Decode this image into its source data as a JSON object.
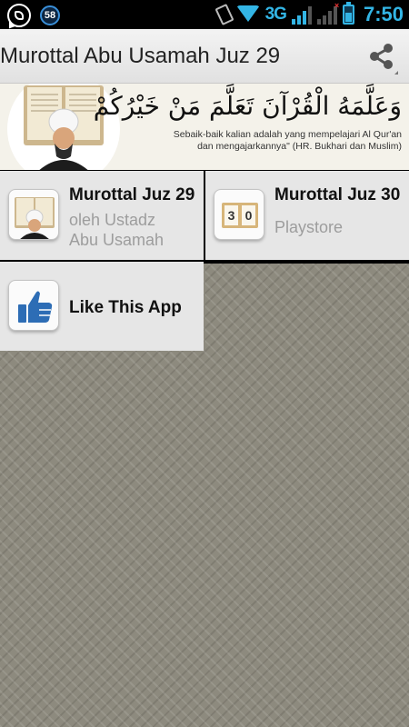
{
  "status_bar": {
    "notification_count": "58",
    "network": "3G",
    "time": "7:50",
    "accent_color": "#33b5e5"
  },
  "action_bar": {
    "title": "Murottal Abu Usamah Juz 29",
    "share_icon": "share-icon"
  },
  "banner": {
    "arabic": "وَعَلَّمَهُ الْقُرْآنَ تَعَلَّمَ مَنْ خَيْرُكُمْ",
    "translation_line1": "Sebaik-baik kalian adalah yang mempelajari Al Qur'an",
    "translation_line2": "dan mengajarkannya\" (HR. Bukhari dan Muslim)"
  },
  "tiles": [
    {
      "title": "Murottal Juz 29",
      "subtitle_line1": "oleh Ustadz",
      "subtitle_line2": "Abu Usamah",
      "icon": "quran-reciter-icon"
    },
    {
      "title": "Murottal Juz 30",
      "subtitle_line1": "Playstore",
      "icon": "juz-30-icon",
      "icon_digits": [
        "3",
        "0"
      ]
    },
    {
      "title": "Like This App",
      "icon": "thumbs-up-icon"
    }
  ]
}
